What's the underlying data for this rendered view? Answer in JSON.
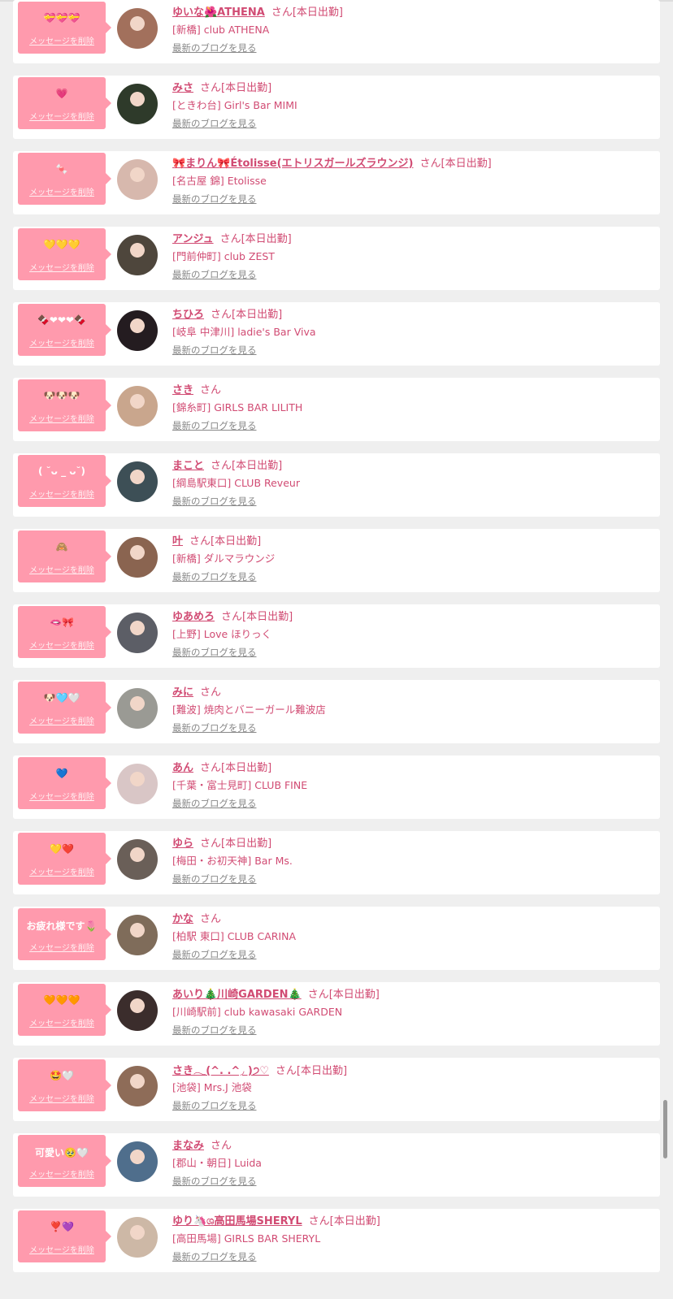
{
  "ui": {
    "delete_label": "メッセージを削除",
    "blog_label": "最新のブログを見る",
    "san_label": "さん",
    "on_duty_label": "[本日出勤]"
  },
  "colors": {
    "bubble": "#ff9aad",
    "accent": "#d14b73",
    "background": "#efefef"
  },
  "messages": [
    {
      "message": "💝💝💝",
      "name": "ゆいな🌺ATHENA",
      "on_duty": true,
      "shop": "[新橋] club ATHENA",
      "avatar_color": "#a2705c"
    },
    {
      "message": "💗",
      "name": "みさ",
      "on_duty": true,
      "shop": "[ときわ台] Girl's Bar MIMI",
      "avatar_color": "#2e3a2a"
    },
    {
      "message": "🍬",
      "name": "🎀まりん🎀Étolisse(エトリスガールズラウンジ)",
      "on_duty": true,
      "shop": "[名古屋 錦] Etolisse",
      "avatar_color": "#d7b8ad"
    },
    {
      "message": "💛💛💛",
      "name": "アンジュ",
      "on_duty": true,
      "shop": "[門前仲町] club ZEST",
      "avatar_color": "#4e463c"
    },
    {
      "message": "🍫❤❤❤🍫",
      "name": "ちひろ",
      "on_duty": true,
      "shop": "[岐阜 中津川] ladie's Bar Viva",
      "avatar_color": "#241c20"
    },
    {
      "message": "🐶🐶🐶",
      "name": "さき",
      "on_duty": false,
      "shop": "[錦糸町] GIRLS BAR LILITH",
      "avatar_color": "#c9a68d"
    },
    {
      "message": "( ˘ᴗ _ ᴗ˘)",
      "name": "まこと",
      "on_duty": true,
      "shop": "[綱島駅東口] CLUB Reveur",
      "avatar_color": "#3d4f56"
    },
    {
      "message": "🙈",
      "name": "叶",
      "on_duty": true,
      "shop": "[新橋] ダルマラウンジ",
      "avatar_color": "#8a6450"
    },
    {
      "message": "🫦🎀",
      "name": "ゆあめろ",
      "on_duty": true,
      "shop": "[上野] Love ほりっく",
      "avatar_color": "#5c5e66"
    },
    {
      "message": "🐶🩵🤍",
      "name": "みに",
      "on_duty": false,
      "shop": "[難波] 焼肉とバニーガール難波店",
      "avatar_color": "#9a9a94"
    },
    {
      "message": "💙",
      "name": "あん",
      "on_duty": true,
      "shop": "[千葉・富士見町] CLUB FINE",
      "avatar_color": "#d9c6c6"
    },
    {
      "message": "💛❤️",
      "name": "ゆら",
      "on_duty": true,
      "shop": "[梅田・お初天神] Bar Ms.",
      "avatar_color": "#6a5f58"
    },
    {
      "message": "お疲れ様です🌷",
      "name": "かな",
      "on_duty": false,
      "shop": "[柏駅 東口] CLUB CARINA",
      "avatar_color": "#7f6c5a"
    },
    {
      "message": "🧡🧡🧡",
      "name": "あいり🎄川崎GARDEN🎄",
      "on_duty": true,
      "shop": "[川崎駅前] club kawasaki GARDEN",
      "avatar_color": "#3b2d2c"
    },
    {
      "message": "🤩🤍",
      "name": "さき𓂃(^. .^◞ )੭♡",
      "on_duty": true,
      "shop": "[池袋] Mrs.J 池袋",
      "avatar_color": "#8e6c58"
    },
    {
      "message": "可愛い🥹🤍",
      "name": "まなみ",
      "on_duty": false,
      "shop": "[郡山・朝日] Luida",
      "avatar_color": "#4f6e8c"
    },
    {
      "message": "❣️💜",
      "name": "ゆり🦄ශ高田馬場SHERYL",
      "on_duty": true,
      "shop": "[高田馬場] GIRLS BAR SHERYL",
      "avatar_color": "#cdb8a6"
    }
  ]
}
